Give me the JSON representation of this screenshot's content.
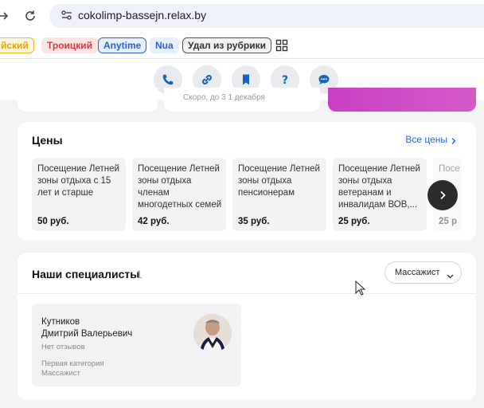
{
  "browser": {
    "url": "cokolimp-bassejn.relax.by"
  },
  "bookmarks": [
    {
      "label": "йский",
      "color": "#e8a200",
      "bg": "#fff7e0",
      "border": "#f0b429"
    },
    {
      "label": "Троицкий",
      "color": "#d63b3b",
      "bg": "#fde4e4",
      "border": "#fde4e4"
    },
    {
      "label": "Anytime",
      "color": "#2f5fcf",
      "bg": "#e6eeff",
      "border": "#2f5fcf"
    },
    {
      "label": "Nua",
      "color": "#2f5fcf",
      "bg": "#e6eeff",
      "border": "#e6eeff"
    },
    {
      "label": "Удал из рубрики",
      "color": "#333333",
      "bg": "#f2f2f2",
      "border": "#555555"
    }
  ],
  "actions": [
    {
      "name": "phone-icon"
    },
    {
      "name": "link-icon"
    },
    {
      "name": "bookmark-icon"
    },
    {
      "name": "help-icon"
    },
    {
      "name": "chat-icon"
    }
  ],
  "prev_section": {
    "text": "Скоро, до 3 1 декабря"
  },
  "prices": {
    "title": "Цены",
    "all_link": "Все цены",
    "items": [
      {
        "name": "Посещение Летней зоны отдыха с 15 лет и старше",
        "price": "50 руб."
      },
      {
        "name": "Посещение Летней зоны отдыха членам многодетных семей",
        "price": "42 руб."
      },
      {
        "name": "Посещение Летней зоны отдыха пенсионерам",
        "price": "35 руб."
      },
      {
        "name": "Посещение Летней зоны отдыха ветеранам и инвалидам ВОВ,...",
        "price": "25 руб."
      },
      {
        "name": "Посе",
        "price": "25 р"
      }
    ]
  },
  "specialists": {
    "title": "Наши специалисты",
    "count": "1",
    "filter_value": "Массажист",
    "people": [
      {
        "name_line1": "Кутников",
        "name_line2": "Дмитрий Валерьевич",
        "reviews": "Нет отзывов",
        "category": "Первая категория",
        "role": "Массажист"
      }
    ]
  },
  "colors": {
    "accent": "#2a6ae0",
    "brand_icon": "#1565c0",
    "promo_magenta": "#cf3fc0"
  }
}
